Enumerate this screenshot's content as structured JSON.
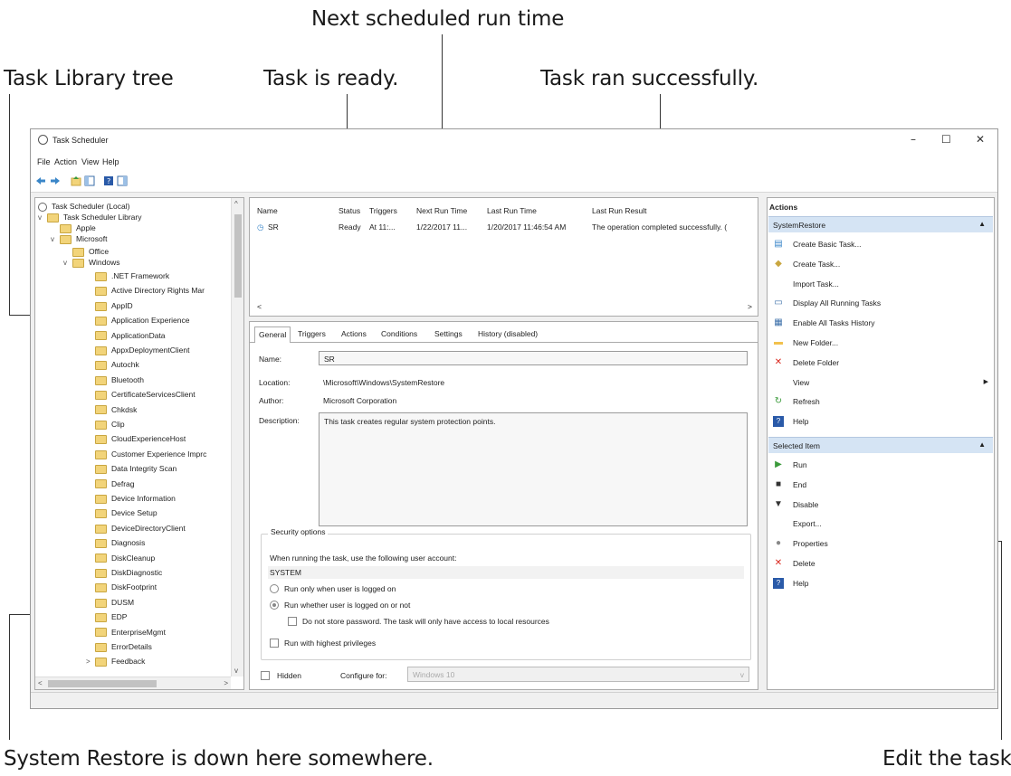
{
  "callouts": {
    "next_run": "Next scheduled run time",
    "library_tree": "Task Library tree",
    "task_ready": "Task is ready.",
    "task_ran": "Task ran successfully.",
    "system_restore": "System Restore is down here somewhere.",
    "edit_task": "Edit the task"
  },
  "window": {
    "title": "Task Scheduler",
    "minimize": "–",
    "maximize": "☐",
    "close": "✕"
  },
  "menu": [
    "File",
    "Action",
    "View",
    "Help"
  ],
  "tree": {
    "root": "Task Scheduler (Local)",
    "library": "Task Scheduler Library",
    "apple": "Apple",
    "microsoft": "Microsoft",
    "office": "Office",
    "windows": "Windows",
    "items": [
      ".NET Framework",
      "Active Directory Rights Mar",
      "AppID",
      "Application Experience",
      "ApplicationData",
      "AppxDeploymentClient",
      "Autochk",
      "Bluetooth",
      "CertificateServicesClient",
      "Chkdsk",
      "Clip",
      "CloudExperienceHost",
      "Customer Experience Imprc",
      "Data Integrity Scan",
      "Defrag",
      "Device Information",
      "Device Setup",
      "DeviceDirectoryClient",
      "Diagnosis",
      "DiskCleanup",
      "DiskDiagnostic",
      "DiskFootprint",
      "DUSM",
      "EDP",
      "EnterpriseMgmt",
      "ErrorDetails",
      "Feedback"
    ]
  },
  "list": {
    "headers": [
      "Name",
      "Status",
      "Triggers",
      "Next Run Time",
      "Last Run Time",
      "Last Run Result"
    ],
    "row": {
      "name": "SR",
      "status": "Ready",
      "triggers": "At 11:...",
      "next_run": "1/22/2017 11...",
      "last_run": "1/20/2017 11:46:54 AM",
      "result": "The operation completed successfully. (",
      "scroll_left": "<",
      "scroll_right": ">"
    }
  },
  "detail": {
    "tabs": [
      "General",
      "Triggers",
      "Actions",
      "Conditions",
      "Settings",
      "History (disabled)"
    ],
    "name_label": "Name:",
    "name_value": "SR",
    "location_label": "Location:",
    "location_value": "\\Microsoft\\Windows\\SystemRestore",
    "author_label": "Author:",
    "author_value": "Microsoft Corporation",
    "description_label": "Description:",
    "description_value": "This task creates regular system protection points.",
    "security_legend": "Security options",
    "account_prompt": "When running the task, use the following user account:",
    "account": "SYSTEM",
    "opt_logged_on": "Run only when user is logged on",
    "opt_whether": "Run whether user is logged on or not",
    "opt_no_store": "Do not store password.  The task will only have access to local resources",
    "opt_highest": "Run with highest privileges",
    "hidden_label": "Hidden",
    "configure_label": "Configure for:",
    "configure_value": "Windows 10"
  },
  "actions": {
    "header": "Actions",
    "section1": "SystemRestore",
    "section1_items": [
      "Create Basic Task...",
      "Create Task...",
      "Import Task...",
      "Display All Running Tasks",
      "Enable All Tasks History",
      "New Folder...",
      "Delete Folder",
      "View",
      "Refresh",
      "Help"
    ],
    "section2": "Selected Item",
    "section2_items": [
      "Run",
      "End",
      "Disable",
      "Export...",
      "Properties",
      "Delete",
      "Help"
    ]
  },
  "colors": {
    "section_bg": "#d5e4f4",
    "folder": "#f2d47a",
    "delete_red": "#d9261c"
  }
}
